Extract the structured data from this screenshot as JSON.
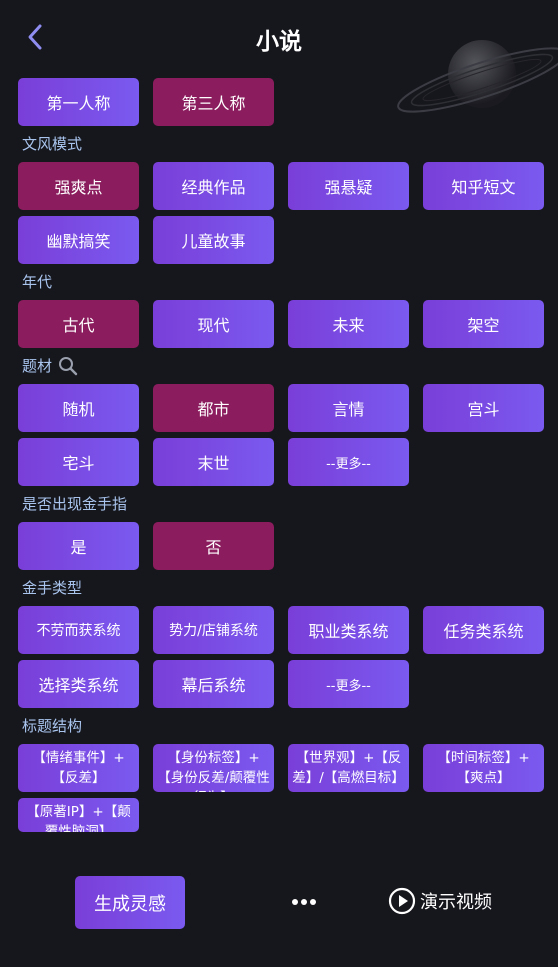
{
  "header": {
    "title": "小说"
  },
  "person": {
    "options": [
      {
        "label": "第一人称",
        "selected": false
      },
      {
        "label": "第三人称",
        "selected": true
      }
    ]
  },
  "style": {
    "label": "文风模式",
    "options": [
      {
        "label": "强爽点",
        "selected": true
      },
      {
        "label": "经典作品",
        "selected": false
      },
      {
        "label": "强悬疑",
        "selected": false
      },
      {
        "label": "知乎短文",
        "selected": false
      },
      {
        "label": "幽默搞笑",
        "selected": false
      },
      {
        "label": "儿童故事",
        "selected": false
      }
    ]
  },
  "era": {
    "label": "年代",
    "options": [
      {
        "label": "古代",
        "selected": true
      },
      {
        "label": "现代",
        "selected": false
      },
      {
        "label": "未来",
        "selected": false
      },
      {
        "label": "架空",
        "selected": false
      }
    ]
  },
  "theme": {
    "label": "题材",
    "options": [
      {
        "label": "随机",
        "selected": false
      },
      {
        "label": "都市",
        "selected": true
      },
      {
        "label": "言情",
        "selected": false
      },
      {
        "label": "宫斗",
        "selected": false
      },
      {
        "label": "宅斗",
        "selected": false
      },
      {
        "label": "末世",
        "selected": false
      },
      {
        "label": "--更多--",
        "selected": false
      }
    ]
  },
  "cheat": {
    "label": "是否出现金手指",
    "options": [
      {
        "label": "是",
        "selected": false
      },
      {
        "label": "否",
        "selected": true
      }
    ]
  },
  "cheat_type": {
    "label": "金手类型",
    "options": [
      {
        "label": "不劳而获系统"
      },
      {
        "label": "势力/店铺系统"
      },
      {
        "label": "职业类系统"
      },
      {
        "label": "任务类系统"
      },
      {
        "label": "选择类系统"
      },
      {
        "label": "幕后系统"
      },
      {
        "label": "--更多--"
      }
    ]
  },
  "title_struct": {
    "label": "标题结构",
    "options": [
      {
        "label": "【情绪事件】+【反差】"
      },
      {
        "label": "【身份标签】+【身份反差/颠覆性行为】"
      },
      {
        "label": "【世界观】+【反差】/【高燃目标】"
      },
      {
        "label": "【时间标签】+【爽点】"
      },
      {
        "label": "【原著IP】+【颠覆性脑洞】"
      }
    ]
  },
  "bottom": {
    "generate_label": "生成灵感",
    "demo_label": "演示视频"
  }
}
